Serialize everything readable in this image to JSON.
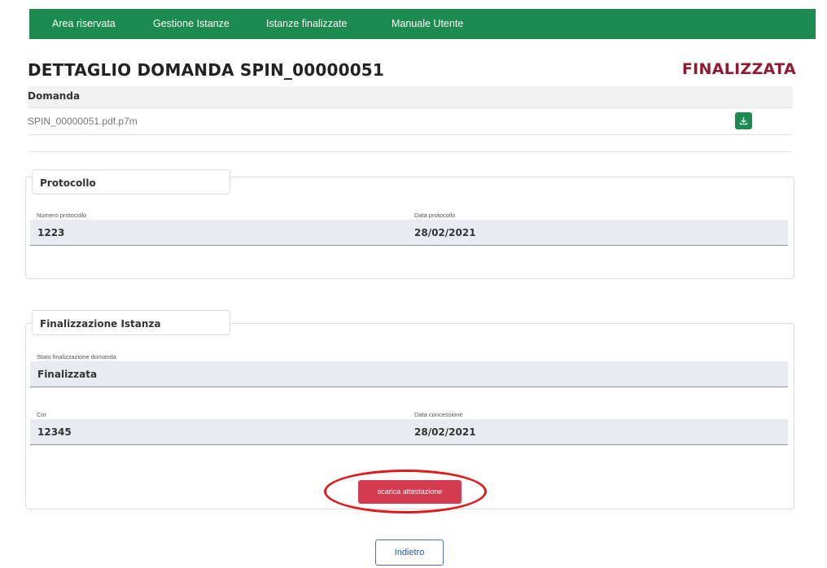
{
  "nav": {
    "items": [
      "Area riservata",
      "Gestione Istanze",
      "Istanze finalizzate",
      "Manuale Utente"
    ]
  },
  "page": {
    "title": "DETTAGLIO DOMANDA SPIN_00000051",
    "status": "FINALIZZATA"
  },
  "domanda": {
    "header": "Domanda",
    "file_name": "SPIN_00000051.pdf.p7m",
    "download_icon": "download-icon"
  },
  "protocollo": {
    "legend": "Protocollo",
    "numero_label": "Numero protocollo",
    "numero_value": "1223",
    "data_label": "Data protocollo",
    "data_value": "28/02/2021"
  },
  "finalizzazione": {
    "legend": "Finalizzazione Istanza",
    "stato_label": "Stato finalizzazione domanda",
    "stato_value": "Finalizzata",
    "cor_label": "Cor",
    "cor_value": "12345",
    "data_concessione_label": "Data concessione",
    "data_concessione_value": "28/02/2021",
    "scarica_label": "scarica attestazione"
  },
  "footer": {
    "indietro_label": "Indietro"
  },
  "colors": {
    "nav_green": "#1d8a4f",
    "status_red": "#8e1b32",
    "button_red": "#d43a50",
    "highlight": "#e11b1b"
  }
}
